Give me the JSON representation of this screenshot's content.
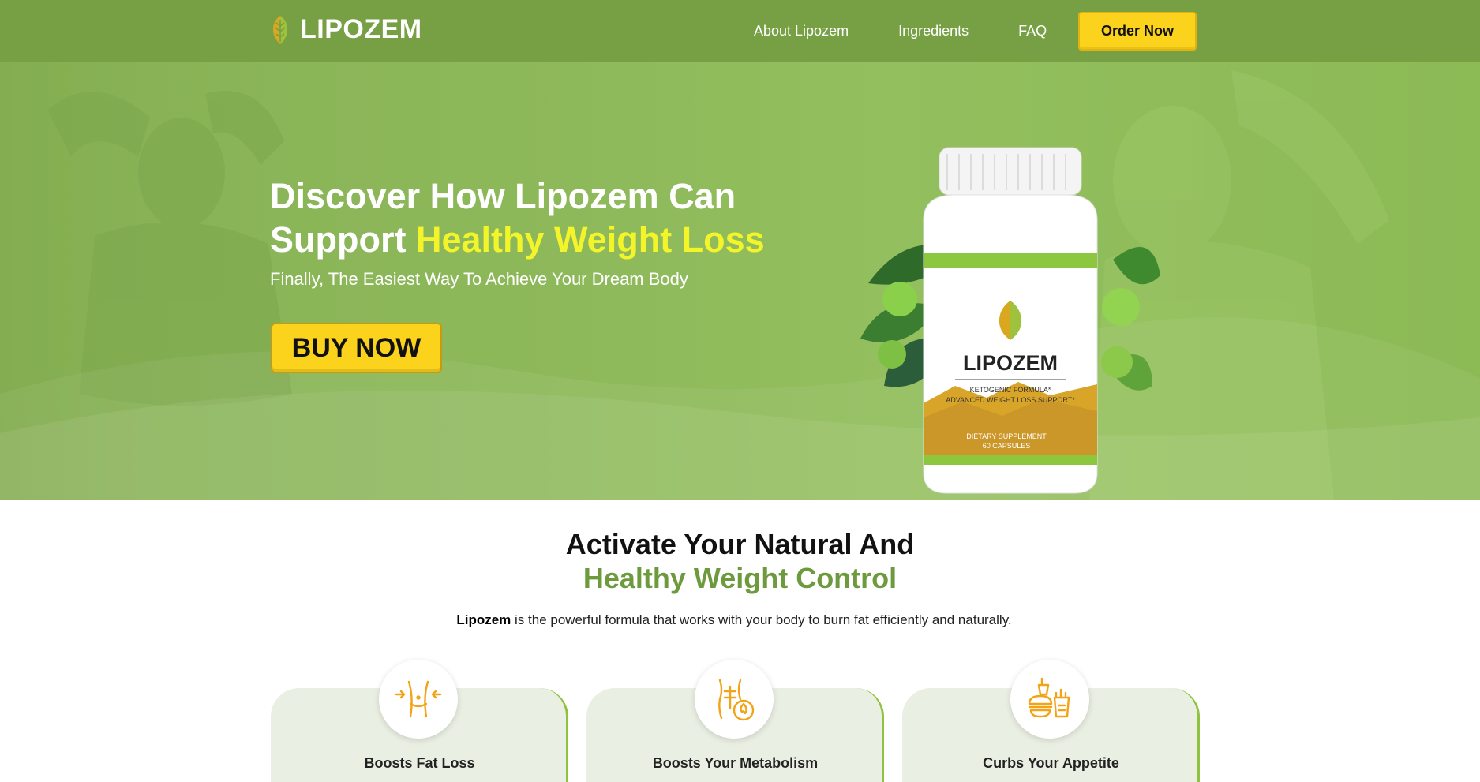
{
  "brand": {
    "name": "LIPOZEM",
    "accent_color": "#77a045",
    "highlight_color": "#f3f52a",
    "button_color": "#fcd31c"
  },
  "nav": {
    "links": [
      "About Lipozem",
      "Ingredients",
      "FAQ"
    ],
    "cta": "Order Now"
  },
  "hero": {
    "title_line1": "Discover How Lipozem Can",
    "title_line2_prefix": "Support ",
    "title_line2_highlight": "Healthy Weight Loss",
    "subtitle": "Finally, The Easiest Way To Achieve Your Dream Body",
    "button": "BUY NOW",
    "bottle": {
      "brand": "LIPOZEM",
      "line1": "KETOGENIC FORMULA*",
      "line2": "ADVANCED WEIGHT LOSS SUPPORT*",
      "line3": "DIETARY SUPPLEMENT",
      "line4": "60 CAPSULES"
    }
  },
  "intro": {
    "title_line1": "Activate Your Natural And",
    "title_line2": "Healthy Weight Control",
    "desc_bold": "Lipozem",
    "desc_rest": " is the powerful formula that works with your body to burn fat efficiently and naturally."
  },
  "features": [
    {
      "title": "Boosts Fat Loss",
      "icon": "waist-icon"
    },
    {
      "title": "Boosts Your Metabolism",
      "icon": "metabolism-icon"
    },
    {
      "title": "Curbs Your Appetite",
      "icon": "fast-food-icon"
    }
  ]
}
